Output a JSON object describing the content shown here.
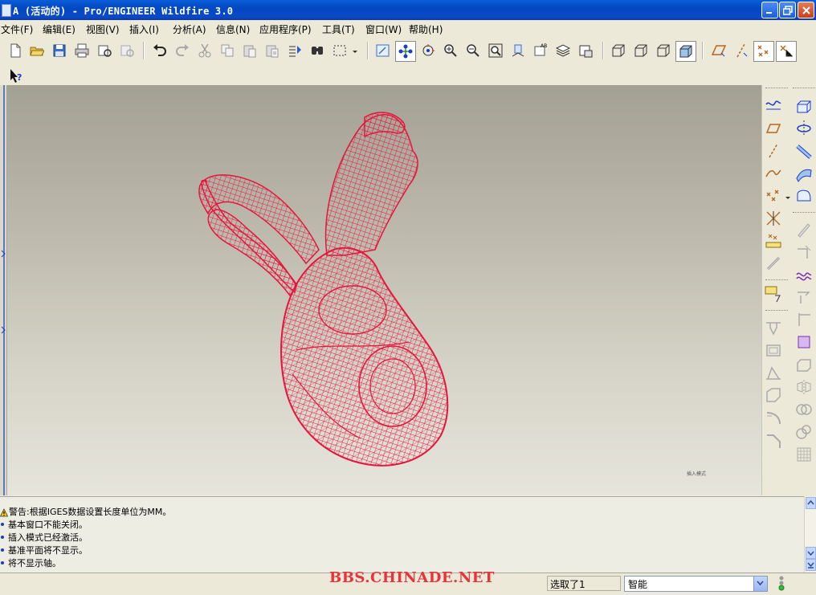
{
  "window": {
    "title": "A (活动的) - Pro/ENGINEER Wildfire 3.0"
  },
  "menu": [
    {
      "label": "文件(F)"
    },
    {
      "label": "编辑(E)"
    },
    {
      "label": "视图(V)"
    },
    {
      "label": "插入(I)"
    },
    {
      "label": "分析(A)"
    },
    {
      "label": "信息(N)"
    },
    {
      "label": "应用程序(P)"
    },
    {
      "label": "工具(T)"
    },
    {
      "label": "窗口(W)"
    },
    {
      "label": "帮助(H)"
    }
  ],
  "graphics": {
    "mode_label": "插入模式",
    "model_color": "#e8143c"
  },
  "messages": [
    {
      "type": "warning",
      "text": "警告:根据IGES数据设置长度单位为MM。"
    },
    {
      "type": "info",
      "text": "基本窗口不能关闭。"
    },
    {
      "type": "info",
      "text": "插入模式已经激活。"
    },
    {
      "type": "info",
      "text": "基准平面将不显示。"
    },
    {
      "type": "info",
      "text": "将不显示轴。"
    }
  ],
  "status": {
    "watermark": "BBS.CHINADE.NET",
    "selection": "选取了1",
    "filter_value": "智能"
  },
  "colors": {
    "titlebar": "#0a4fd0",
    "background": "#ece9d8",
    "accent_red": "#e8143c"
  }
}
